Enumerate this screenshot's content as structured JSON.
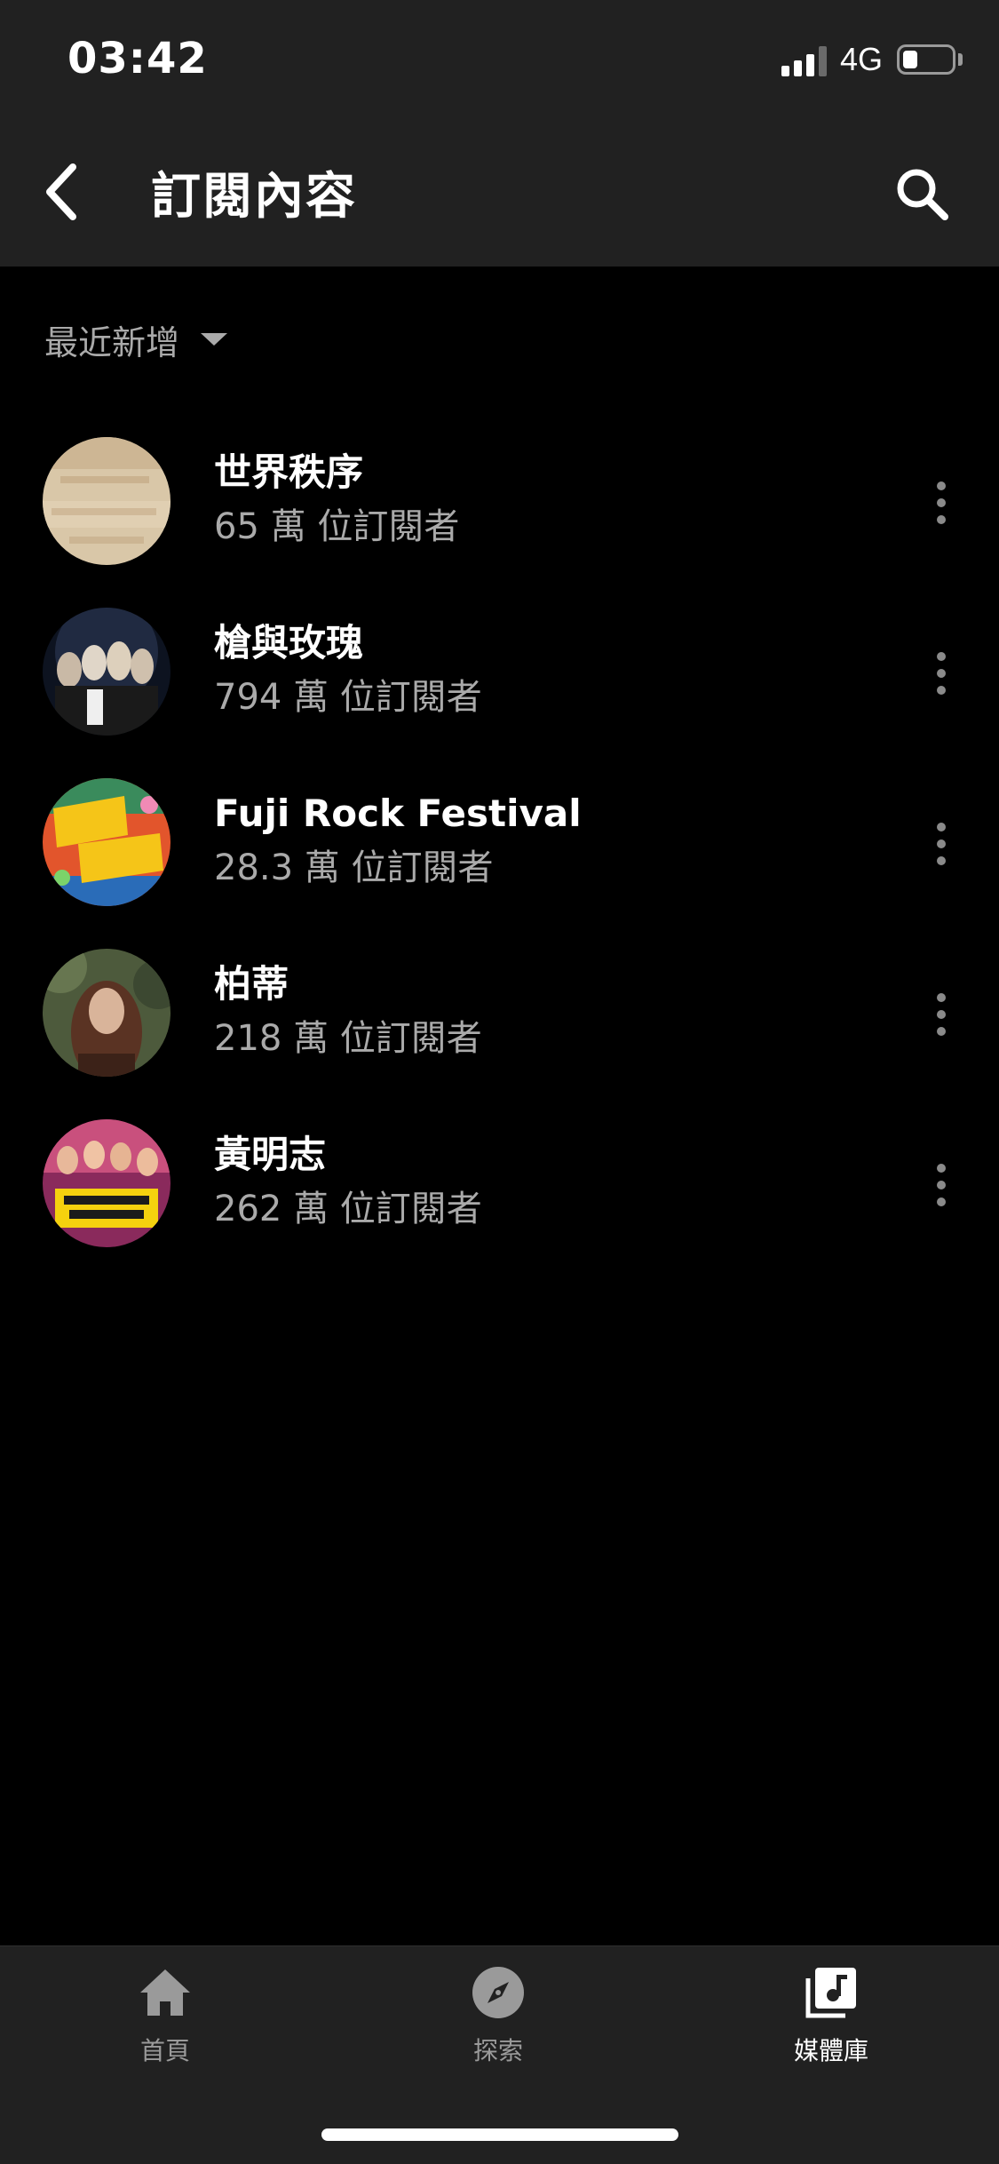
{
  "status_bar": {
    "time": "03:42",
    "network": "4G",
    "signal_bars": 3,
    "signal_bars_total": 4,
    "battery_level": 0.3
  },
  "header": {
    "title": "訂閱內容",
    "back_icon": "chevron-left-icon",
    "search_icon": "search-icon"
  },
  "sort": {
    "label": "最近新增",
    "icon": "caret-down-icon"
  },
  "subscriptions": [
    {
      "name": "世界秩序",
      "subscribers": "65 萬 位訂閱者"
    },
    {
      "name": "槍與玫瑰",
      "subscribers": "794 萬 位訂閱者"
    },
    {
      "name": "Fuji Rock Festival",
      "subscribers": "28.3 萬 位訂閱者"
    },
    {
      "name": "柏蒂",
      "subscribers": "218 萬 位訂閱者"
    },
    {
      "name": "黃明志",
      "subscribers": "262 萬 位訂閱者"
    }
  ],
  "bottom_nav": {
    "items": [
      {
        "label": "首頁",
        "icon": "home-icon",
        "active": false
      },
      {
        "label": "探索",
        "icon": "compass-icon",
        "active": false
      },
      {
        "label": "媒體庫",
        "icon": "library-icon",
        "active": true
      }
    ]
  },
  "colors": {
    "background": "#000000",
    "bar": "#212121",
    "secondary_text": "#aaaaaa"
  }
}
